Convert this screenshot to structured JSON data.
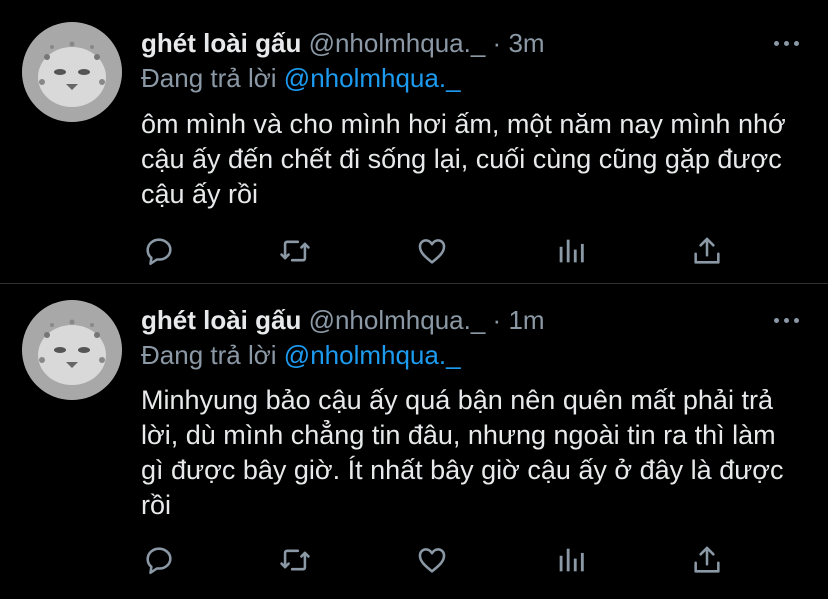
{
  "tweets": [
    {
      "display_name": "ghét loài gấu",
      "handle": "@nholmhqua._",
      "separator": "·",
      "time": "3m",
      "reply_prefix": "Đang trả lời",
      "reply_to": "@nholmhqua._",
      "text": "ôm mình và cho mình hơi ấm, một năm nay mình nhớ cậu ấy đến chết đi sống lại, cuối cùng cũng gặp được cậu ấy rồi",
      "icons": [
        "reply-icon",
        "retweet-icon",
        "like-icon",
        "analytics-icon",
        "share-icon"
      ]
    },
    {
      "display_name": "ghét loài gấu",
      "handle": "@nholmhqua._",
      "separator": "·",
      "time": "1m",
      "reply_prefix": "Đang trả lời",
      "reply_to": "@nholmhqua._",
      "text": "Minhyung bảo cậu ấy quá bận nên quên mất phải trả lời, dù mình chẳng tin đâu, nhưng ngoài tin ra thì làm gì được bây giờ. Ít nhất bây giờ cậu ấy ở đây là được rồi",
      "icons": [
        "reply-icon",
        "retweet-icon",
        "like-icon",
        "analytics-icon",
        "share-icon"
      ]
    }
  ],
  "colors": {
    "background": "#000000",
    "text": "#e7e9ea",
    "secondary": "#8b98a5",
    "link": "#1d9bf0",
    "divider": "#2f3336"
  }
}
